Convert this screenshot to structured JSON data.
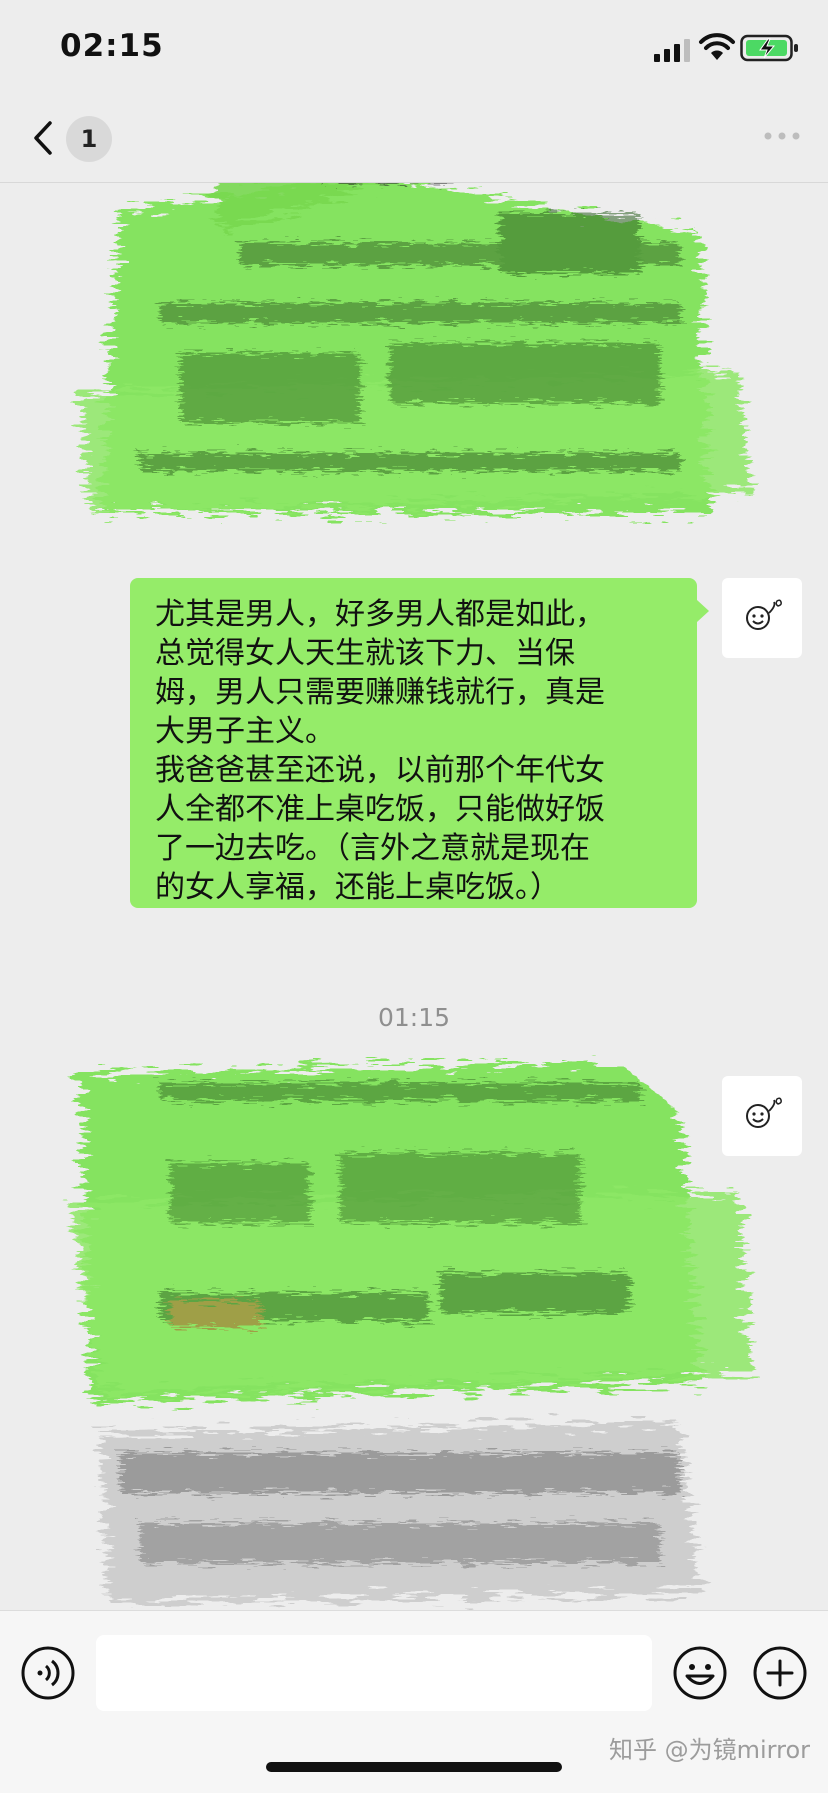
{
  "status_bar": {
    "time": "02:15",
    "icons": [
      "signal-icon",
      "wifi-icon",
      "battery-charging-icon"
    ],
    "battery_color": "#4cd964"
  },
  "nav": {
    "back_icon": "chevron-left-icon",
    "unread_count": "1",
    "more_icon": "more-dots-icon"
  },
  "chat": {
    "bubble_color": "#95ec69",
    "messages": [
      {
        "id": "msg-1",
        "side": "right",
        "redacted": true
      },
      {
        "id": "msg-2",
        "side": "right",
        "text": "尤其是男人，好多男人都是如此，\n总觉得女人天生就该下力、当保\n姆，男人只需要赚赚钱就行，真是\n大男子主义。\n我爸爸甚至还说，以前那个年代女\n人全都不准上桌吃饭，只能做好饭\n了一边去吃。（言外之意就是现在\n的女人享福，还能上桌吃饭。）"
      },
      {
        "id": "msg-3",
        "side": "right",
        "redacted": true
      }
    ],
    "timestamp": "01:15",
    "avatar_icon": "smiley-avatar-icon"
  },
  "input_bar": {
    "voice_icon": "voice-icon",
    "emoji_icon": "emoji-icon",
    "add_icon": "plus-icon",
    "placeholder": ""
  },
  "watermark": "知乎 @为镜mirror"
}
